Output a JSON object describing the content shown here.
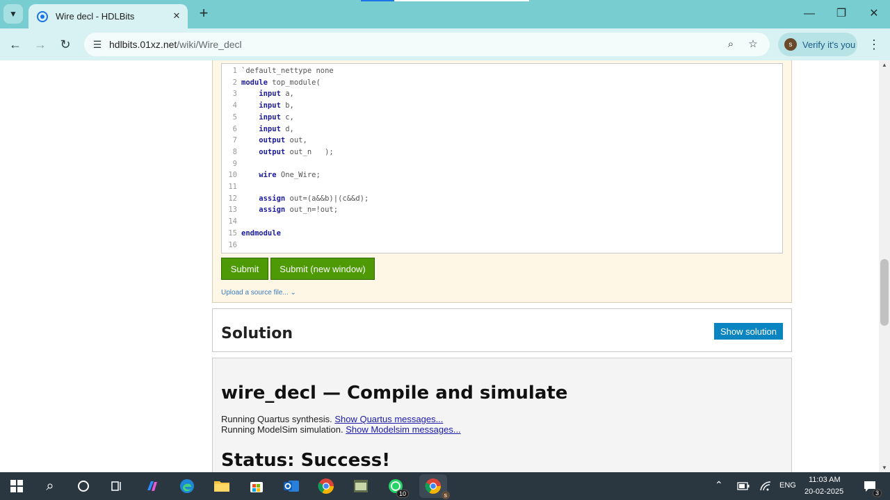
{
  "browser": {
    "tab_title": "Wire decl - HDLBits",
    "url_host": "hdlbits.01xz.net",
    "url_path": "/wiki/Wire_decl",
    "profile_label": "Verify it's you",
    "profile_initial": "s"
  },
  "editor": {
    "lines": [
      {
        "num": "1",
        "kw": "",
        "text": "`default_nettype none"
      },
      {
        "num": "2",
        "kw": "module",
        "text": " top_module("
      },
      {
        "num": "3",
        "kw": "    input",
        "text": " a,"
      },
      {
        "num": "4",
        "kw": "    input",
        "text": " b,"
      },
      {
        "num": "5",
        "kw": "    input",
        "text": " c,"
      },
      {
        "num": "6",
        "kw": "    input",
        "text": " d,"
      },
      {
        "num": "7",
        "kw": "    output",
        "text": " out,"
      },
      {
        "num": "8",
        "kw": "    output",
        "text": " out_n   );"
      },
      {
        "num": "9",
        "kw": "",
        "text": ""
      },
      {
        "num": "10",
        "kw": "    wire",
        "text": " One_Wire;"
      },
      {
        "num": "11",
        "kw": "",
        "text": ""
      },
      {
        "num": "12",
        "kw": "    assign",
        "text": " out=(a&&b)|(c&&d);"
      },
      {
        "num": "13",
        "kw": "    assign",
        "text": " out_n=!out;"
      },
      {
        "num": "14",
        "kw": "",
        "text": ""
      },
      {
        "num": "15",
        "kw": "endmodule",
        "text": ""
      },
      {
        "num": "16",
        "kw": "",
        "text": ""
      }
    ],
    "submit_label": "Submit",
    "submit_new_window_label": "Submit (new window)",
    "upload_label": "Upload a source file... ⌄"
  },
  "solution": {
    "title": "Solution",
    "show_label": "Show solution"
  },
  "result": {
    "title": "wire_decl — Compile and simulate",
    "quartus_text": "Running Quartus synthesis.",
    "quartus_link": "Show Quartus messages...",
    "modelsim_text": "Running ModelSim simulation.",
    "modelsim_link": "Show Modelsim messages...",
    "status": "Status: Success!"
  },
  "taskbar": {
    "whatsapp_badge": "10",
    "chrome_initial": "s",
    "language": "ENG",
    "time": "11:03 AM",
    "date": "20-02-2025",
    "notification_count": "3"
  },
  "colors": {
    "chrome_teal": "#78cdd1",
    "submit_green": "#4e9a06",
    "solution_blue": "#0b85c2",
    "editor_bg": "#fef7e6"
  }
}
